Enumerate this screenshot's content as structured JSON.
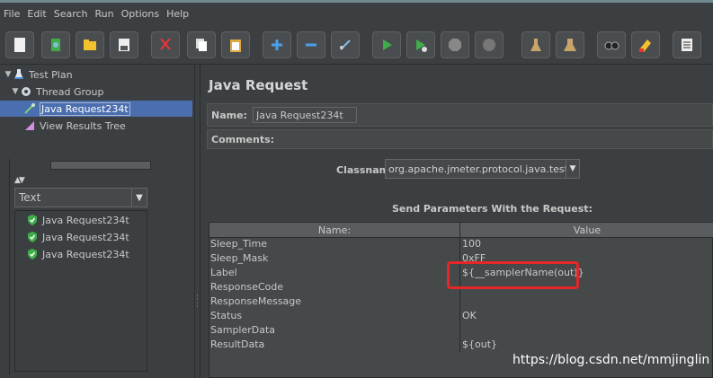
{
  "menu": [
    "File",
    "Edit",
    "Search",
    "Run",
    "Options",
    "Help"
  ],
  "toolbar_icons": [
    "new-file-icon",
    "templates-icon",
    "open-icon",
    "save-icon",
    "cut-icon",
    "copy-icon",
    "paste-icon",
    "expand-icon",
    "collapse-icon",
    "toggle-icon",
    "start-icon",
    "start-no-pause-icon",
    "stop-icon",
    "shutdown-icon",
    "clear-icon",
    "clear-all-icon",
    "search-icon",
    "reset-search-icon",
    "function-helper-icon"
  ],
  "tree": {
    "test_plan": "Test Plan",
    "thread_group": "Thread Group",
    "java_request": "Java Request234t",
    "view_results": "View Results Tree"
  },
  "results_panel": {
    "renderer": "Text",
    "items": [
      "Java Request234t",
      "Java Request234t",
      "Java Request234t"
    ]
  },
  "main": {
    "title": "Java Request",
    "name_label": "Name:",
    "name_value": "Java Request234t",
    "comments_label": "Comments:",
    "classname_label": "Classname:",
    "classname_value": "org.apache.jmeter.protocol.java.test.JavaTest",
    "params_title": "Send Parameters With the Request:",
    "table": {
      "headers": [
        "Name:",
        "Value"
      ],
      "rows": [
        {
          "name": "Sleep_Time",
          "value": "100"
        },
        {
          "name": "Sleep_Mask",
          "value": "0xFF"
        },
        {
          "name": "Label",
          "value": "${__samplerName(out)}"
        },
        {
          "name": "ResponseCode",
          "value": ""
        },
        {
          "name": "ResponseMessage",
          "value": ""
        },
        {
          "name": "Status",
          "value": "OK"
        },
        {
          "name": "SamplerData",
          "value": ""
        },
        {
          "name": "ResultData",
          "value": "${out}"
        }
      ]
    }
  },
  "watermark": "https://blog.csdn.net/mmjinglin",
  "colors": {
    "background": "#3c3f41",
    "selection": "#4b6eaf",
    "highlight": "#e52727",
    "check": "#3fae49"
  }
}
